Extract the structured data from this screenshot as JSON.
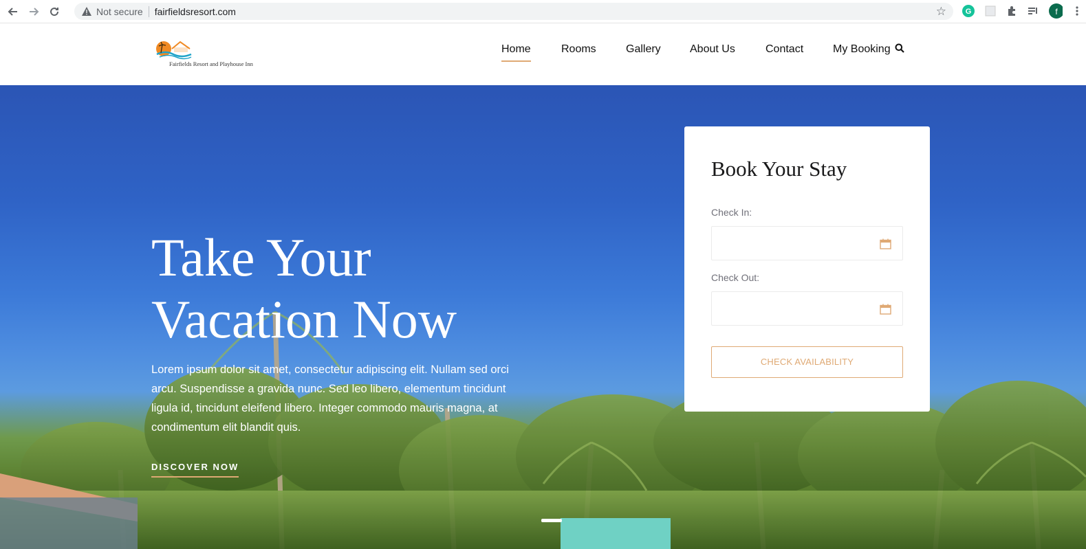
{
  "browser": {
    "security_label": "Not secure",
    "url": "fairfieldsresort.com",
    "profile_initial": "f"
  },
  "site": {
    "logo_text": "Fairfields Resort and Playhouse Inn",
    "nav": [
      {
        "label": "Home",
        "active": true
      },
      {
        "label": "Rooms"
      },
      {
        "label": "Gallery"
      },
      {
        "label": "About Us"
      },
      {
        "label": "Contact"
      },
      {
        "label": "My Booking"
      }
    ]
  },
  "hero": {
    "title_line1": "Take Your",
    "title_line2": "Vacation Now",
    "text": "Lorem ipsum dolor sit amet, consectetur adipiscing elit. Nullam sed orci arcu. Suspendisse a gravida nunc. Sed leo libero, elementum tincidunt ligula id, tincidunt eleifend libero. Integer commodo mauris magna, at condimentum elit blandit quis.",
    "cta": "DISCOVER NOW"
  },
  "booking": {
    "title": "Book Your Stay",
    "check_in_label": "Check In:",
    "check_in_value": "",
    "check_out_label": "Check Out:",
    "check_out_value": "",
    "button": "CHECK AVAILABILITY"
  },
  "colors": {
    "accent": "#dfa974",
    "sky": "#2f63c6"
  }
}
